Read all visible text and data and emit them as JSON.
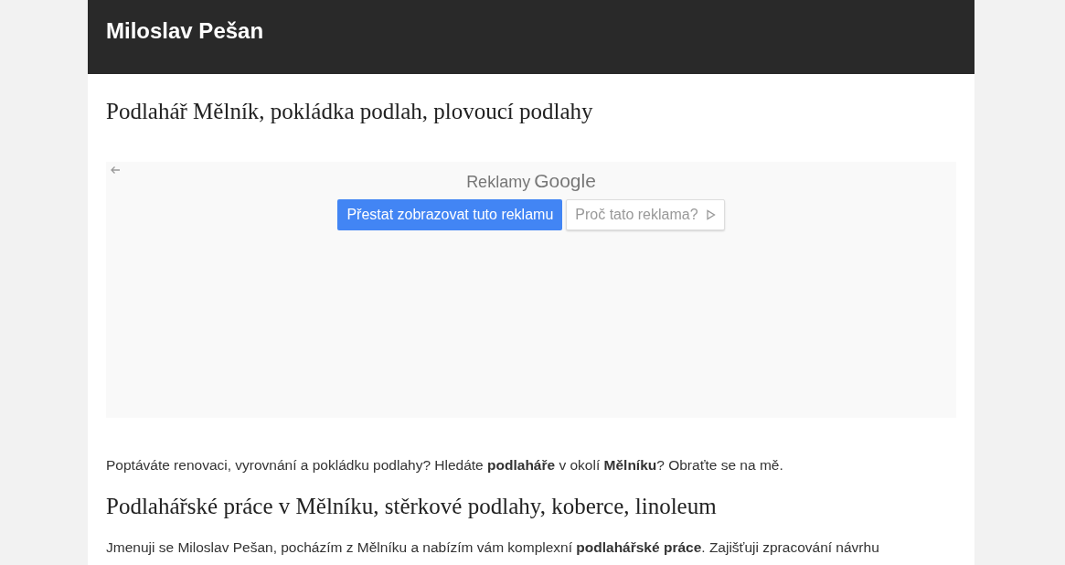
{
  "header": {
    "title": "Miloslav Pešan"
  },
  "heading": "Podlahář Mělník, pokládka podlah, plovoucí podlahy",
  "ad": {
    "label": "Reklamy",
    "brand": "Google",
    "buttons": [
      {
        "label": "Přestat zobrazovat tuto reklamu",
        "kind": "primary"
      },
      {
        "label": "Proč tato reklama?",
        "kind": "info"
      }
    ]
  },
  "content": [
    {
      "kind": "paragraph",
      "text": "Poptáváte renovaci, vyrovnání a pokládku podlahy? Hledáte **podlaháře** v okolí **Mělníku**? Obraťte se na mě."
    },
    {
      "kind": "heading",
      "text": "Podlahářské práce v Mělníku, stěrkové podlahy, koberce, linoleum"
    },
    {
      "kind": "paragraph",
      "text": "Jmenuji se Miloslav Pešan, pocházím z Mělníku a nabízím vám komplexní **podlahářské práce**. Zajišťuji zpracování návrhu"
    }
  ]
}
